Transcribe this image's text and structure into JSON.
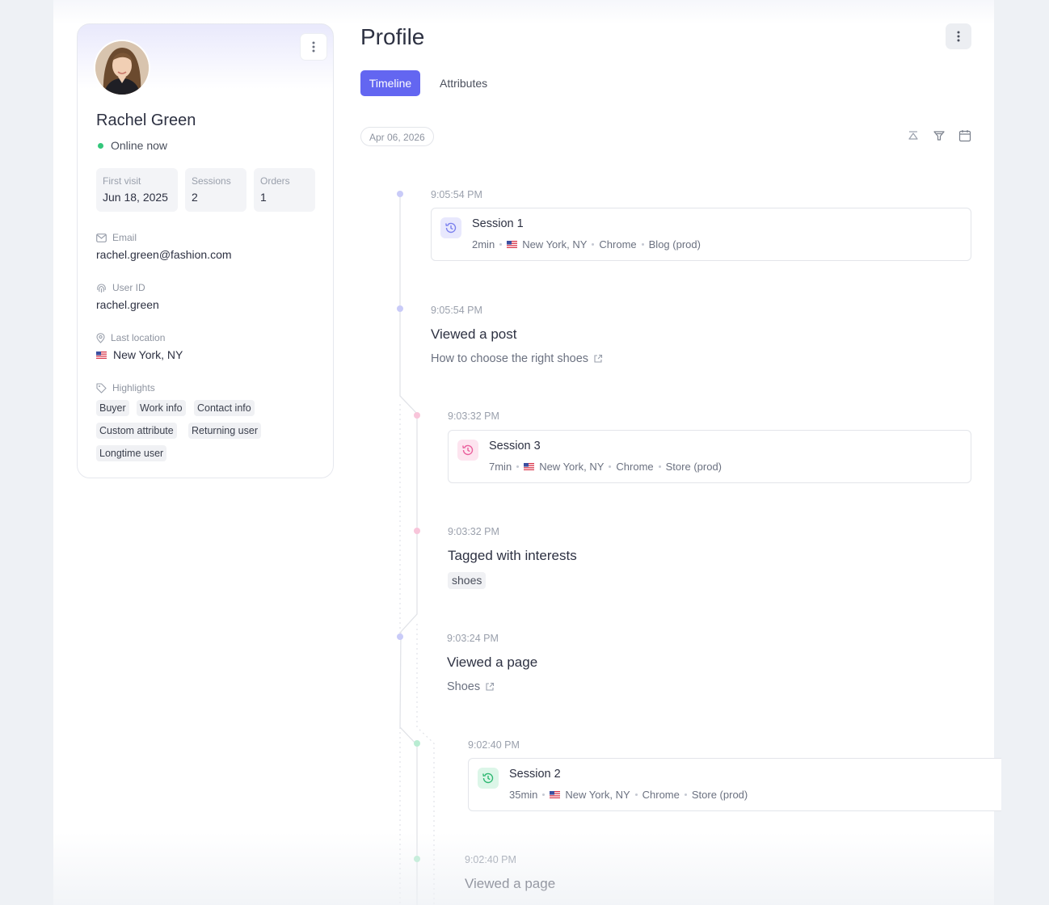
{
  "profile": {
    "name": "Rachel Green",
    "status": "Online now",
    "stats": [
      {
        "label": "First visit",
        "value": "Jun 18, 2025"
      },
      {
        "label": "Sessions",
        "value": "2"
      },
      {
        "label": "Orders",
        "value": "1"
      }
    ],
    "email": {
      "label": "Email",
      "value": "rachel.green@fashion.com"
    },
    "user_id": {
      "label": "User ID",
      "value": "rachel.green"
    },
    "location": {
      "label": "Last location",
      "value": "New York, NY"
    },
    "highlights": {
      "label": "Highlights",
      "tags": [
        "Buyer",
        "Work info",
        "Contact info",
        "Custom attribute",
        "Returning user",
        "Longtime user"
      ]
    }
  },
  "header": {
    "title": "Profile",
    "tabs": [
      "Timeline",
      "Attributes"
    ]
  },
  "timeline": {
    "date": "Apr 06, 2026",
    "events": [
      {
        "time": "9:05:54 PM",
        "type": "session",
        "title": "Session 1",
        "duration": "2min",
        "location": "New York, NY",
        "browser": "Chrome",
        "site": "Blog (prod)",
        "color": "#8b8ff0"
      },
      {
        "time": "9:05:54 PM",
        "type": "post",
        "title": "Viewed a post",
        "link": "How to choose the right shoes"
      },
      {
        "time": "9:03:32 PM",
        "type": "session",
        "title": "Session 3",
        "duration": "7min",
        "location": "New York, NY",
        "browser": "Chrome",
        "site": "Store (prod)",
        "color": "#ee6fa6"
      },
      {
        "time": "9:03:32 PM",
        "type": "interests",
        "title": "Tagged with interests",
        "chip": "shoes"
      },
      {
        "time": "9:03:24 PM",
        "type": "page",
        "title": "Viewed a page",
        "link": "Shoes"
      },
      {
        "time": "9:02:40 PM",
        "type": "session",
        "title": "Session 2",
        "duration": "35min",
        "location": "New York, NY",
        "browser": "Chrome",
        "site": "Store (prod)",
        "color": "#36c07a"
      },
      {
        "time": "9:02:40 PM",
        "type": "page",
        "title": "Viewed a page"
      }
    ]
  },
  "colors": {
    "accent": "#6366f1",
    "online": "#34c77b",
    "session1": "#8b8ff0",
    "session3": "#ee6fa6",
    "session2": "#36c07a"
  }
}
